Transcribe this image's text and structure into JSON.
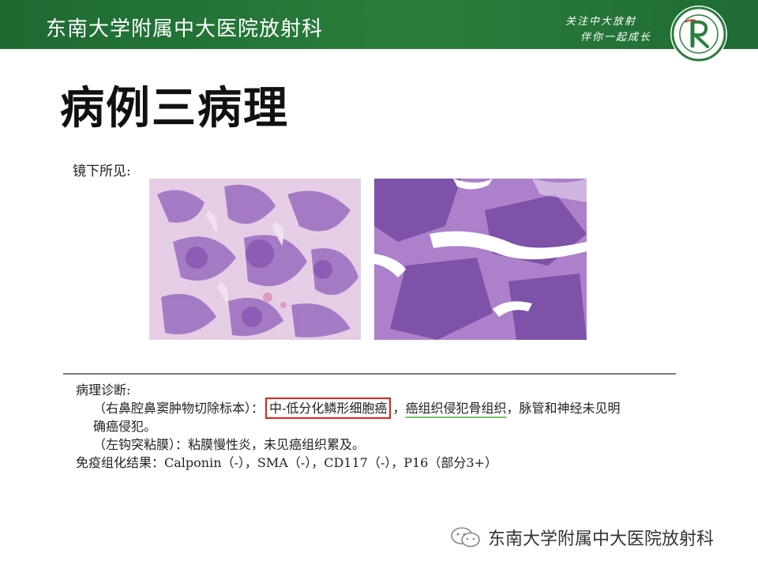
{
  "header": {
    "title": "东南大学附属中大医院放射科",
    "slogan_line1": "关注中大放射",
    "slogan_line2": "伴你一起成长",
    "logo_icon": "hospital-radiology-logo-icon",
    "brand_color": "#2a7d3c"
  },
  "page_title": "病例三病理",
  "microscopy": {
    "label": "镜下所见:"
  },
  "report": {
    "heading": "病理诊断:",
    "line1_prefix": "（右鼻腔鼻窦肿物切除标本）：",
    "line1_highlight": "中-低分化鳞形细胞癌",
    "line1_comma": "，",
    "line1_underlined": "癌组织侵犯骨组织",
    "line1_suffix": "，脉管和神经未见明",
    "line2": "确癌侵犯。",
    "line3": "（左钩突粘膜）：粘膜慢性炎，未见癌组织累及。",
    "line4": "免疫组化结果：Calponin（-），SMA（-），CD117（-），P16（部分3+）"
  },
  "watermark": {
    "icon": "wechat-icon",
    "text": "东南大学附属中大医院放射科"
  }
}
